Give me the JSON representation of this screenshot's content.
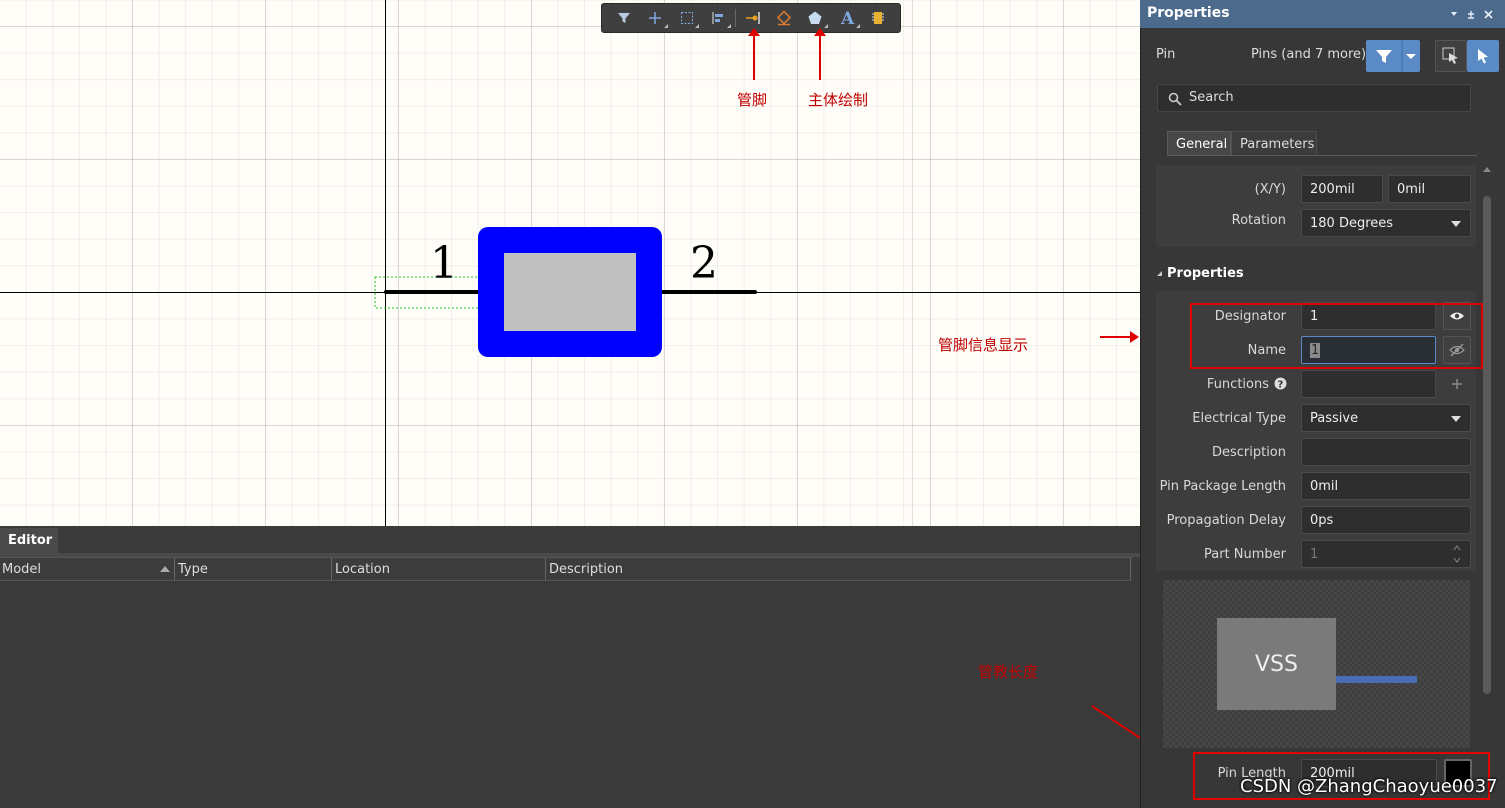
{
  "toolbar": {
    "buttons": [
      "filter-icon",
      "add-icon",
      "select-rect-icon",
      "align-icon",
      "pin-icon",
      "eraser-icon",
      "polygon-icon",
      "text-icon",
      "component-icon"
    ]
  },
  "annotations": {
    "pin": "管脚",
    "body": "主体绘制",
    "pin_info": "管脚信息显示",
    "pin_length": "管教长度"
  },
  "canvas": {
    "pin1": "1",
    "pin2": "2"
  },
  "editor": {
    "tab": "Editor",
    "columns": [
      "Model",
      "Type",
      "Location",
      "Description"
    ]
  },
  "properties": {
    "title": "Properties",
    "object_type": "Pin",
    "filter_summary": "Pins (and 7 more)",
    "search_placeholder": "Search",
    "tabs": [
      "General",
      "Parameters"
    ],
    "location": {
      "label": "(X/Y)",
      "x": "200mil",
      "y": "0mil"
    },
    "rotation": {
      "label": "Rotation",
      "value": "180 Degrees"
    },
    "section_title": "Properties",
    "designator": {
      "label": "Designator",
      "value": "1"
    },
    "name": {
      "label": "Name",
      "value": "1"
    },
    "functions": {
      "label": "Functions"
    },
    "electrical_type": {
      "label": "Electrical Type",
      "value": "Passive"
    },
    "description": {
      "label": "Description",
      "value": ""
    },
    "pin_package_length": {
      "label": "Pin Package Length",
      "value": "0mil"
    },
    "propagation_delay": {
      "label": "Propagation Delay",
      "value": "0ps"
    },
    "part_number": {
      "label": "Part Number",
      "value": "1"
    },
    "preview_label": "VSS",
    "pin_length": {
      "label": "Pin Length",
      "value": "200mil"
    }
  },
  "watermark": "CSDN @ZhangChaoyue0037",
  "colors": {
    "body_fill": "#0000ff",
    "body_inner": "#c0c0c0",
    "annotation": "#e00000",
    "title_bar": "#4b6a8c"
  }
}
